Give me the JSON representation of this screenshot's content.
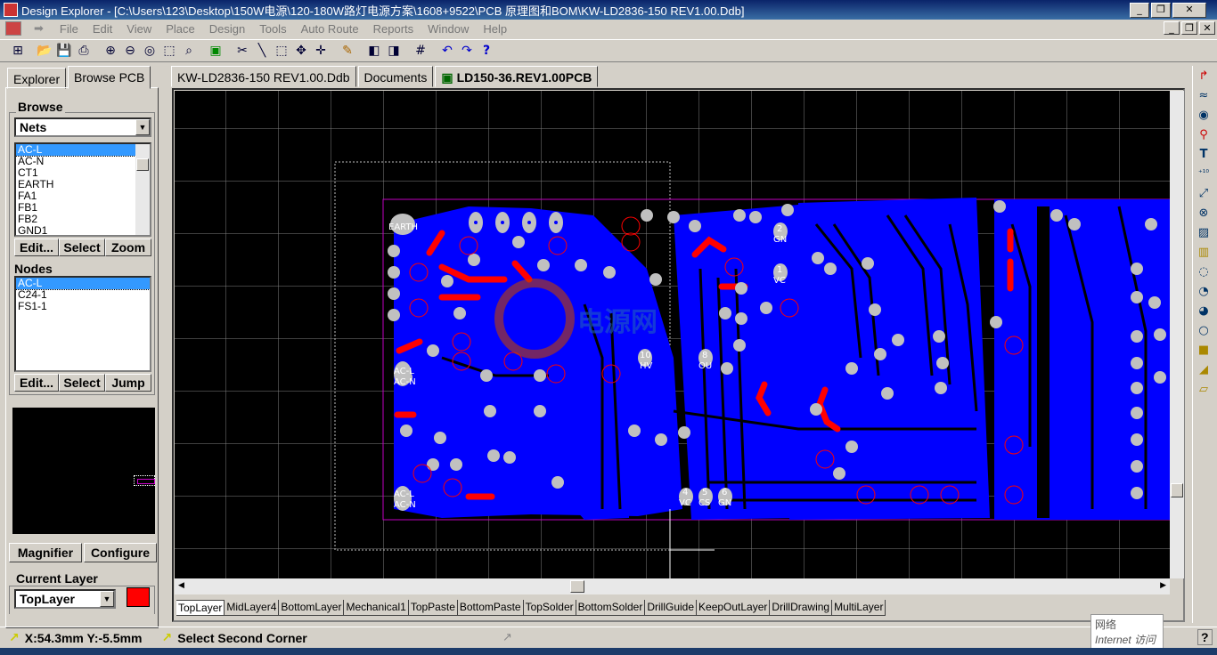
{
  "window": {
    "title": "Design Explorer - [C:\\Users\\123\\Desktop\\150W电源\\120-180W路灯电源方案\\1608+9522\\PCB 原理图和BOM\\KW-LD2836-150 REV1.00.Ddb]",
    "minimize": "_",
    "restore": "❐",
    "close": "✕"
  },
  "menu": [
    "File",
    "Edit",
    "View",
    "Place",
    "Design",
    "Tools",
    "Auto Route",
    "Reports",
    "Window",
    "Help"
  ],
  "toolbar_icons": [
    "components-icon",
    "open-icon",
    "save-icon",
    "print-icon",
    "zoom-in-icon",
    "zoom-out-icon",
    "zoom-fit-icon",
    "zoom-area-icon",
    "zoom-select-icon",
    "board-icon",
    "cut-icon",
    "wire-icon",
    "select-icon",
    "move-select-icon",
    "move-icon",
    "pencil-icon",
    "library-icon",
    "library2-icon",
    "grid-icon",
    "undo-icon",
    "redo-icon",
    "help-icon"
  ],
  "left": {
    "tabs": [
      "Explorer",
      "Browse PCB"
    ],
    "browse_label": "Browse",
    "browse_value": "Nets",
    "nets": [
      "AC-L",
      "AC-N",
      "CT1",
      "EARTH",
      "FA1",
      "FB1",
      "FB2",
      "GND1"
    ],
    "nets_buttons": [
      "Edit...",
      "Select",
      "Zoom"
    ],
    "nodes_label": "Nodes",
    "nodes": [
      "AC-L",
      "C24-1",
      "FS1-1"
    ],
    "nodes_buttons": [
      "Edit...",
      "Select",
      "Jump"
    ],
    "magnifier": "Magnifier",
    "configure": "Configure",
    "current_layer_label": "Current Layer",
    "current_layer": "TopLayer",
    "layer_color": "#ff0000"
  },
  "doc_tabs": [
    "KW-LD2836-150 REV1.00.Ddb",
    "Documents",
    "LD150-36.REV1.00PCB"
  ],
  "layers": [
    "TopLayer",
    "MidLayer4",
    "BottomLayer",
    "Mechanical1",
    "TopPaste",
    "BottomPaste",
    "TopSolder",
    "BottomSolder",
    "DrillGuide",
    "KeepOutLayer",
    "DrillDrawing",
    "MultiLayer"
  ],
  "pcb_labels": [
    "EARTH",
    "AC-L",
    "AC-N",
    "AC-L",
    "AC-N",
    "2",
    "GN",
    "1",
    "VC",
    "10",
    "HV",
    "8",
    "OU",
    "4",
    "VC",
    "5",
    "CS",
    "6",
    "GN"
  ],
  "watermark": "电源网",
  "status": {
    "coords": "X:54.3mm Y:-5.5mm",
    "message": "Select Second Corner"
  },
  "net_popup": {
    "line1": "网络",
    "line2": "Internet 访问"
  },
  "colors": {
    "board_blue": "#0000ff",
    "track_red": "#ff0000",
    "pad_gray": "#c0c0c0",
    "grid": "#808080",
    "outline": "#c000c0"
  }
}
